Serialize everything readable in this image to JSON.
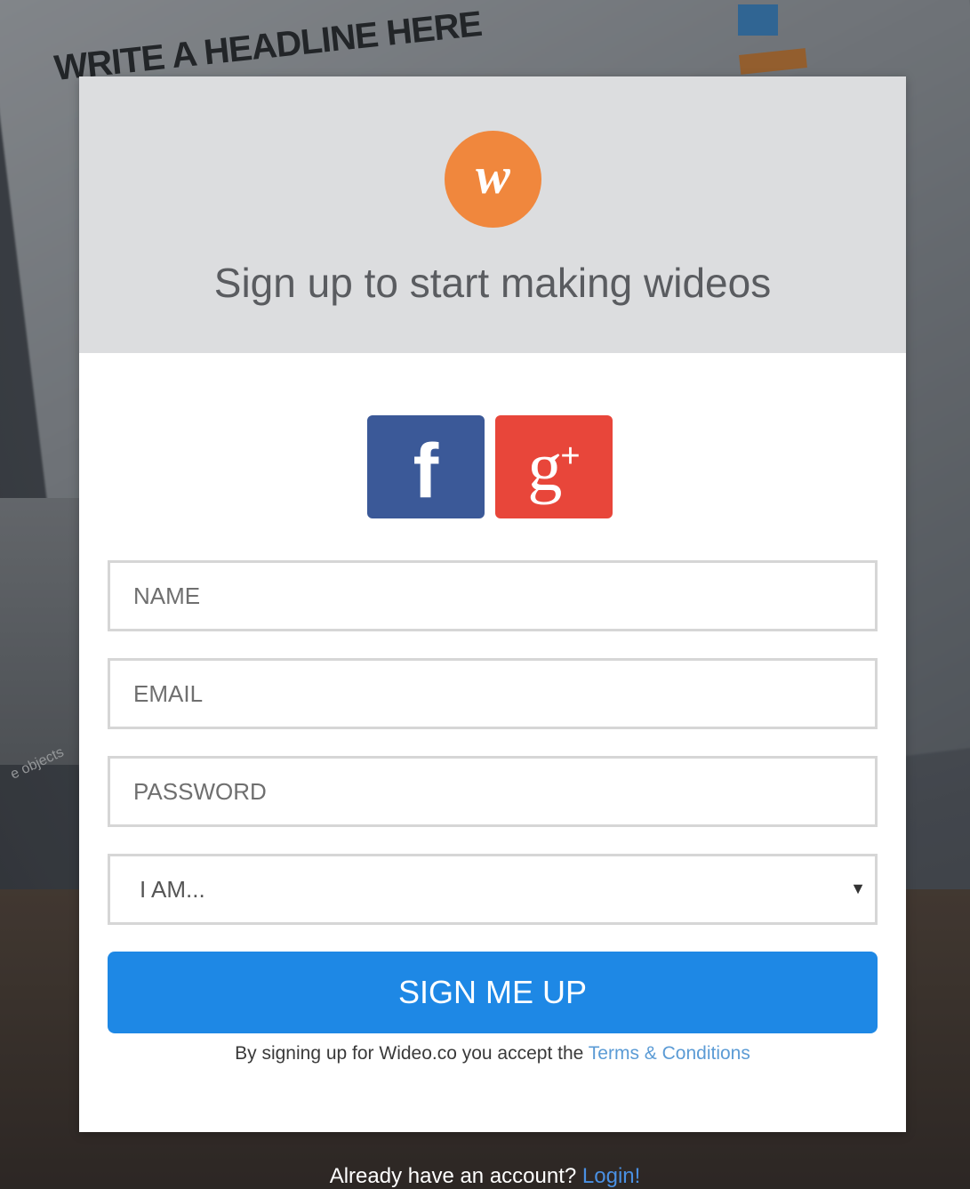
{
  "background": {
    "headline": "WRITE A HEADLINE HERE",
    "side_text": "e objects"
  },
  "card": {
    "logo_letter": "w",
    "headline": "Sign up to start making wideos",
    "social": {
      "facebook_glyph": "f",
      "google_glyph": "g",
      "google_plus": "+"
    },
    "form": {
      "name_placeholder": "NAME",
      "email_placeholder": "EMAIL",
      "password_placeholder": "PASSWORD",
      "role_select_value": "I AM...",
      "role_select_arrow": "▼",
      "submit_label": "SIGN ME UP"
    },
    "terms": {
      "prefix": "By signing up for Wideo.co you accept the ",
      "link_label": "Terms & Conditions"
    }
  },
  "footer": {
    "prompt": "Already have an account? ",
    "login_label": "Login!"
  },
  "colors": {
    "logo_orange": "#f0873d",
    "facebook_blue": "#3b5998",
    "google_red": "#e8463a",
    "primary_button": "#1e88e5",
    "link": "#5b9bd5"
  }
}
